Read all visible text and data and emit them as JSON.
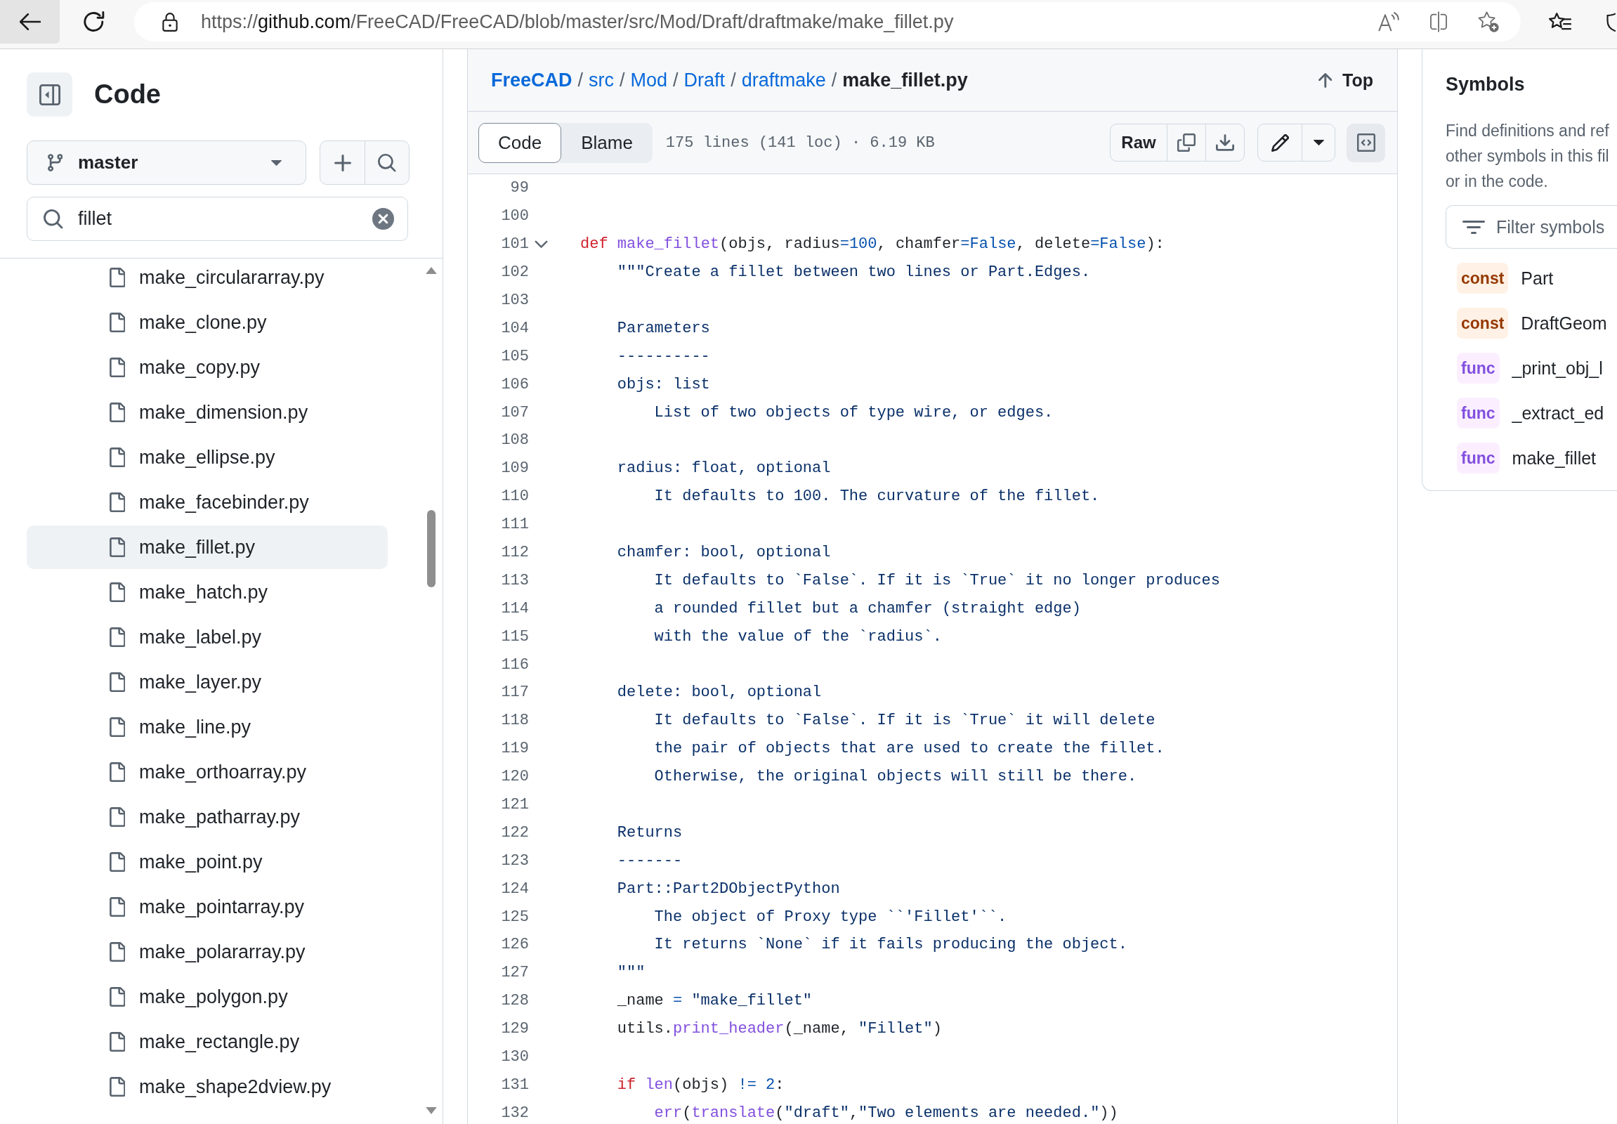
{
  "browser": {
    "url": {
      "parts": [
        {
          "text": "https://",
          "highlight": false
        },
        {
          "text": "github.com",
          "highlight": true
        },
        {
          "text": "/FreeCAD/FreeCAD/blob/master/src/Mod/Draft/draftmake/make_fillet.py",
          "highlight": false
        }
      ]
    }
  },
  "sidebar": {
    "title": "Code",
    "branch": "master",
    "search": {
      "value": "fillet"
    },
    "files": [
      {
        "name": "make_circulararray.py",
        "selected": false
      },
      {
        "name": "make_clone.py",
        "selected": false
      },
      {
        "name": "make_copy.py",
        "selected": false
      },
      {
        "name": "make_dimension.py",
        "selected": false
      },
      {
        "name": "make_ellipse.py",
        "selected": false
      },
      {
        "name": "make_facebinder.py",
        "selected": false
      },
      {
        "name": "make_fillet.py",
        "selected": true
      },
      {
        "name": "make_hatch.py",
        "selected": false
      },
      {
        "name": "make_label.py",
        "selected": false
      },
      {
        "name": "make_layer.py",
        "selected": false
      },
      {
        "name": "make_line.py",
        "selected": false
      },
      {
        "name": "make_orthoarray.py",
        "selected": false
      },
      {
        "name": "make_patharray.py",
        "selected": false
      },
      {
        "name": "make_point.py",
        "selected": false
      },
      {
        "name": "make_pointarray.py",
        "selected": false
      },
      {
        "name": "make_polararray.py",
        "selected": false
      },
      {
        "name": "make_polygon.py",
        "selected": false
      },
      {
        "name": "make_rectangle.py",
        "selected": false
      },
      {
        "name": "make_shape2dview.py",
        "selected": false
      }
    ]
  },
  "file_header": {
    "breadcrumb": [
      {
        "kind": "repo",
        "text": "FreeCAD"
      },
      {
        "kind": "separator",
        "text": "/"
      },
      {
        "kind": "dir",
        "text": "src"
      },
      {
        "kind": "separator",
        "text": "/"
      },
      {
        "kind": "dir",
        "text": "Mod"
      },
      {
        "kind": "separator",
        "text": "/"
      },
      {
        "kind": "dir",
        "text": "Draft"
      },
      {
        "kind": "separator",
        "text": "/"
      },
      {
        "kind": "dir",
        "text": "draftmake"
      },
      {
        "kind": "separator",
        "text": "/"
      },
      {
        "kind": "file",
        "text": "make_fillet.py"
      }
    ],
    "top_label": "Top"
  },
  "toolbar": {
    "views": [
      {
        "label": "Code",
        "selected": true
      },
      {
        "label": "Blame",
        "selected": false
      }
    ],
    "info": "175 lines (141 loc) · 6.19 KB",
    "raw_label": "Raw",
    "symbols_pane_open": true
  },
  "code": {
    "lines": [
      {
        "number": "99"
      },
      {
        "number": "100"
      },
      {
        "number": "101",
        "fold": {
          "expanded": true
        },
        "tokens": [
          {
            "kind": "keyword",
            "text": "def "
          },
          {
            "kind": "function",
            "text": "make_fillet"
          },
          {
            "kind": "plain",
            "text": "(objs, radius"
          },
          {
            "kind": "constant",
            "text": "=100"
          },
          {
            "kind": "plain",
            "text": ", chamfer"
          },
          {
            "kind": "constant",
            "text": "=False"
          },
          {
            "kind": "plain",
            "text": ", delete"
          },
          {
            "kind": "constant",
            "text": "=False"
          },
          {
            "kind": "plain",
            "text": "):"
          }
        ]
      },
      {
        "number": "102",
        "tokens": [
          {
            "kind": "string",
            "text": "    \"\"\"Create a fillet between two lines or Part.Edges."
          }
        ]
      },
      {
        "number": "103"
      },
      {
        "number": "104",
        "tokens": [
          {
            "kind": "string",
            "text": "    Parameters"
          }
        ]
      },
      {
        "number": "105",
        "tokens": [
          {
            "kind": "string",
            "text": "    ----------"
          }
        ]
      },
      {
        "number": "106",
        "tokens": [
          {
            "kind": "string",
            "text": "    objs: list"
          }
        ]
      },
      {
        "number": "107",
        "tokens": [
          {
            "kind": "string",
            "text": "        List of two objects of type wire, or edges."
          }
        ]
      },
      {
        "number": "108"
      },
      {
        "number": "109",
        "tokens": [
          {
            "kind": "string",
            "text": "    radius: float, optional"
          }
        ]
      },
      {
        "number": "110",
        "tokens": [
          {
            "kind": "string",
            "text": "        It defaults to 100. The curvature of the fillet."
          }
        ]
      },
      {
        "number": "111"
      },
      {
        "number": "112",
        "tokens": [
          {
            "kind": "string",
            "text": "    chamfer: bool, optional"
          }
        ]
      },
      {
        "number": "113",
        "tokens": [
          {
            "kind": "string",
            "text": "        It defaults to `False`. If it is `True` it no longer produces"
          }
        ]
      },
      {
        "number": "114",
        "tokens": [
          {
            "kind": "string",
            "text": "        a rounded fillet but a chamfer (straight edge)"
          }
        ]
      },
      {
        "number": "115",
        "tokens": [
          {
            "kind": "string",
            "text": "        with the value of the `radius`."
          }
        ]
      },
      {
        "number": "116"
      },
      {
        "number": "117",
        "tokens": [
          {
            "kind": "string",
            "text": "    delete: bool, optional"
          }
        ]
      },
      {
        "number": "118",
        "tokens": [
          {
            "kind": "string",
            "text": "        It defaults to `False`. If it is `True` it will delete"
          }
        ]
      },
      {
        "number": "119",
        "tokens": [
          {
            "kind": "string",
            "text": "        the pair of objects that are used to create the fillet."
          }
        ]
      },
      {
        "number": "120",
        "tokens": [
          {
            "kind": "string",
            "text": "        Otherwise, the original objects will still be there."
          }
        ]
      },
      {
        "number": "121"
      },
      {
        "number": "122",
        "tokens": [
          {
            "kind": "string",
            "text": "    Returns"
          }
        ]
      },
      {
        "number": "123",
        "tokens": [
          {
            "kind": "string",
            "text": "    -------"
          }
        ]
      },
      {
        "number": "124",
        "tokens": [
          {
            "kind": "string",
            "text": "    Part::Part2DObjectPython"
          }
        ]
      },
      {
        "number": "125",
        "tokens": [
          {
            "kind": "string",
            "text": "        The object of Proxy type ``'Fillet'``."
          }
        ]
      },
      {
        "number": "126",
        "tokens": [
          {
            "kind": "string",
            "text": "        It returns `None` if it fails producing the object."
          }
        ]
      },
      {
        "number": "127",
        "tokens": [
          {
            "kind": "string",
            "text": "    \"\"\""
          }
        ]
      },
      {
        "number": "128",
        "tokens": [
          {
            "kind": "plain",
            "text": "    _name "
          },
          {
            "kind": "constant",
            "text": "="
          },
          {
            "kind": "string",
            "text": " \"make_fillet\""
          }
        ]
      },
      {
        "number": "129",
        "tokens": [
          {
            "kind": "plain",
            "text": "    utils."
          },
          {
            "kind": "function",
            "text": "print_header"
          },
          {
            "kind": "plain",
            "text": "(_name, "
          },
          {
            "kind": "string",
            "text": "\"Fillet\""
          },
          {
            "kind": "plain",
            "text": ")"
          }
        ]
      },
      {
        "number": "130"
      },
      {
        "number": "131",
        "tokens": [
          {
            "kind": "keyword",
            "text": "    if "
          },
          {
            "kind": "function",
            "text": "len"
          },
          {
            "kind": "plain",
            "text": "(objs) "
          },
          {
            "kind": "constant",
            "text": "!= 2"
          },
          {
            "kind": "plain",
            "text": ":"
          }
        ]
      },
      {
        "number": "132",
        "tokens": [
          {
            "kind": "function",
            "text": "        err"
          },
          {
            "kind": "plain",
            "text": "("
          },
          {
            "kind": "function",
            "text": "translate"
          },
          {
            "kind": "plain",
            "text": "("
          },
          {
            "kind": "string",
            "text": "\"draft\""
          },
          {
            "kind": "plain",
            "text": ","
          },
          {
            "kind": "string",
            "text": "\"Two elements are needed.\""
          },
          {
            "kind": "plain",
            "text": "))"
          }
        ]
      }
    ]
  },
  "symbols": {
    "title": "Symbols",
    "description_lines": [
      "Find definitions and ref",
      "other symbols in this fil",
      "or in the code."
    ],
    "filter": {
      "placeholder": "Filter symbols"
    },
    "items": [
      {
        "kind": "const",
        "badge": "const",
        "name": "Part"
      },
      {
        "kind": "const",
        "badge": "const",
        "name": "DraftGeom"
      },
      {
        "kind": "func",
        "badge": "func",
        "name": "_print_obj_l"
      },
      {
        "kind": "func",
        "badge": "func",
        "name": "_extract_ed"
      },
      {
        "kind": "func",
        "badge": "func",
        "name": "make_fillet"
      }
    ]
  }
}
